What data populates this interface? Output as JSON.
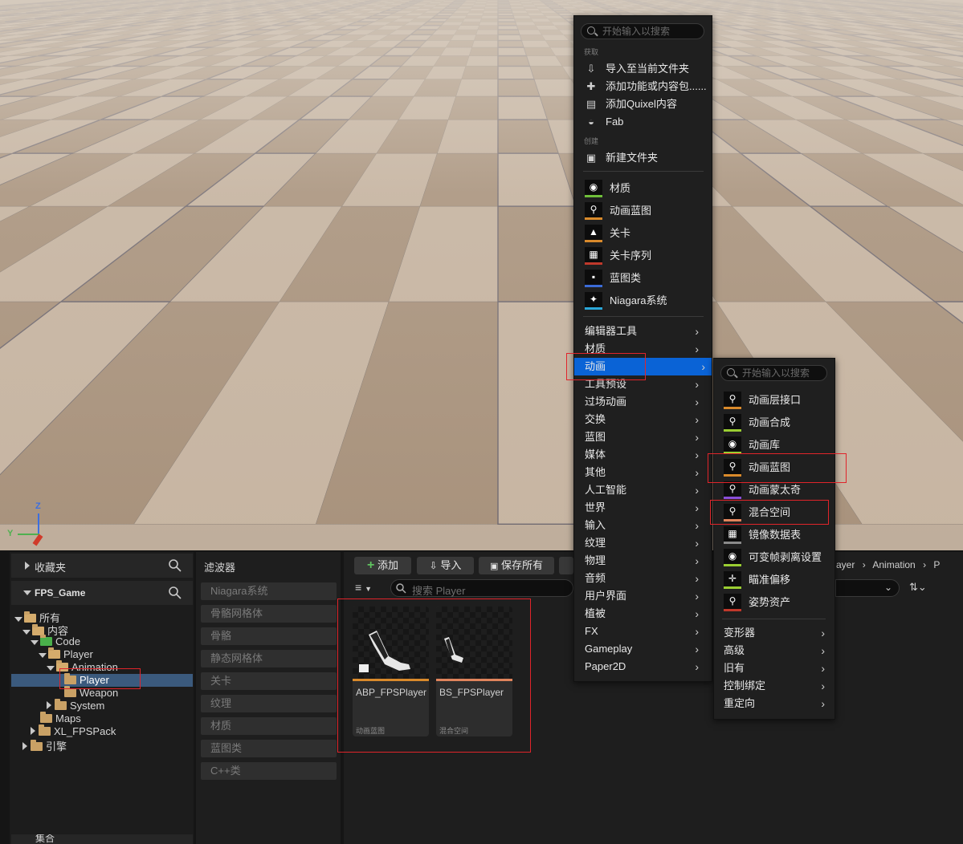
{
  "viewport": {
    "axis": {
      "z": "Z",
      "y": "Y"
    }
  },
  "sidebar": {
    "favorites_label": "收藏夹",
    "project_label": "FPS_Game",
    "tree": [
      {
        "label": "所有"
      },
      {
        "label": "内容"
      },
      {
        "label": "Code"
      },
      {
        "label": "Player"
      },
      {
        "label": "Animation"
      },
      {
        "label": "Player"
      },
      {
        "label": "Weapon"
      },
      {
        "label": "System"
      },
      {
        "label": "Maps"
      },
      {
        "label": "XL_FPSPack"
      },
      {
        "label": "引擎"
      }
    ],
    "collections_label": "集合"
  },
  "filters": {
    "title": "滤波器",
    "items": [
      "Niagara系统",
      "骨骼网格体",
      "骨骼",
      "静态网格体",
      "关卡",
      "纹理",
      "材质",
      "蓝图类",
      "C++类"
    ]
  },
  "toolbar": {
    "add_label": "添加",
    "import_label": "导入",
    "save_all_label": "保存所有",
    "search_placeholder": "搜索 Player",
    "breadcrumb": [
      "ayer",
      "Animation",
      "P"
    ]
  },
  "assets": [
    {
      "name": "ABP_FPSPlayer",
      "type": "动画蓝图",
      "color": "#d98a2b"
    },
    {
      "name": "BS_FPSPlayer",
      "type": "混合空间",
      "color": "#e0845c"
    }
  ],
  "context_menu": {
    "search_placeholder": "开始输入以搜索",
    "section_get": "获取",
    "get_items": [
      {
        "label": "导入至当前文件夹",
        "icon": "import-icon"
      },
      {
        "label": "添加功能或内容包......",
        "icon": "feature-pack-icon"
      },
      {
        "label": "添加Quixel内容",
        "icon": "quixel-icon"
      },
      {
        "label": "Fab",
        "icon": "fab-icon"
      }
    ],
    "section_create": "创建",
    "new_folder": "新建文件夹",
    "asset_items": [
      {
        "label": "材质",
        "icon": "material-icon",
        "color": "#6fbf3a"
      },
      {
        "label": "动画蓝图",
        "icon": "anim-blueprint-icon",
        "color": "#d98a2b"
      },
      {
        "label": "关卡",
        "icon": "level-icon",
        "color": "#d98a2b"
      },
      {
        "label": "关卡序列",
        "icon": "level-sequence-icon",
        "color": "#c0392b"
      },
      {
        "label": "蓝图类",
        "icon": "blueprint-class-icon",
        "color": "#3b6bd6"
      },
      {
        "label": "Niagara系统",
        "icon": "niagara-icon",
        "color": "#2aa7d8"
      }
    ],
    "categories": [
      "编辑器工具",
      "材质",
      "动画",
      "工具预设",
      "过场动画",
      "交换",
      "蓝图",
      "媒体",
      "其他",
      "人工智能",
      "世界",
      "输入",
      "纹理",
      "物理",
      "音频",
      "用户界面",
      "植被",
      "FX",
      "Gameplay",
      "Paper2D"
    ],
    "highlighted": "动画"
  },
  "submenu": {
    "search_placeholder": "开始输入以搜索",
    "items": [
      {
        "label": "动画层接口",
        "icon": "anim-layer-interface-icon",
        "color": "#d98a2b"
      },
      {
        "label": "动画合成",
        "icon": "anim-composite-icon",
        "color": "#9acd32"
      },
      {
        "label": "动画库",
        "icon": "anim-library-icon",
        "color": "#9acd32"
      },
      {
        "label": "动画蓝图",
        "icon": "anim-blueprint-icon",
        "color": "#d98a2b"
      },
      {
        "label": "动画蒙太奇",
        "icon": "anim-montage-icon",
        "color": "#8a4ed8"
      },
      {
        "label": "混合空间",
        "icon": "blend-space-icon",
        "color": "#e0845c"
      },
      {
        "label": "镜像数据表",
        "icon": "mirror-table-icon",
        "color": "#8a8a8a"
      },
      {
        "label": "可变帧剥离设置",
        "icon": "frame-strip-icon",
        "color": "#9acd32"
      },
      {
        "label": "瞄准偏移",
        "icon": "aim-offset-icon",
        "color": "#9acd32"
      },
      {
        "label": "姿势资产",
        "icon": "pose-asset-icon",
        "color": "#c0392b"
      }
    ],
    "more": [
      "变形器",
      "高级",
      "旧有",
      "控制绑定",
      "重定向"
    ]
  }
}
